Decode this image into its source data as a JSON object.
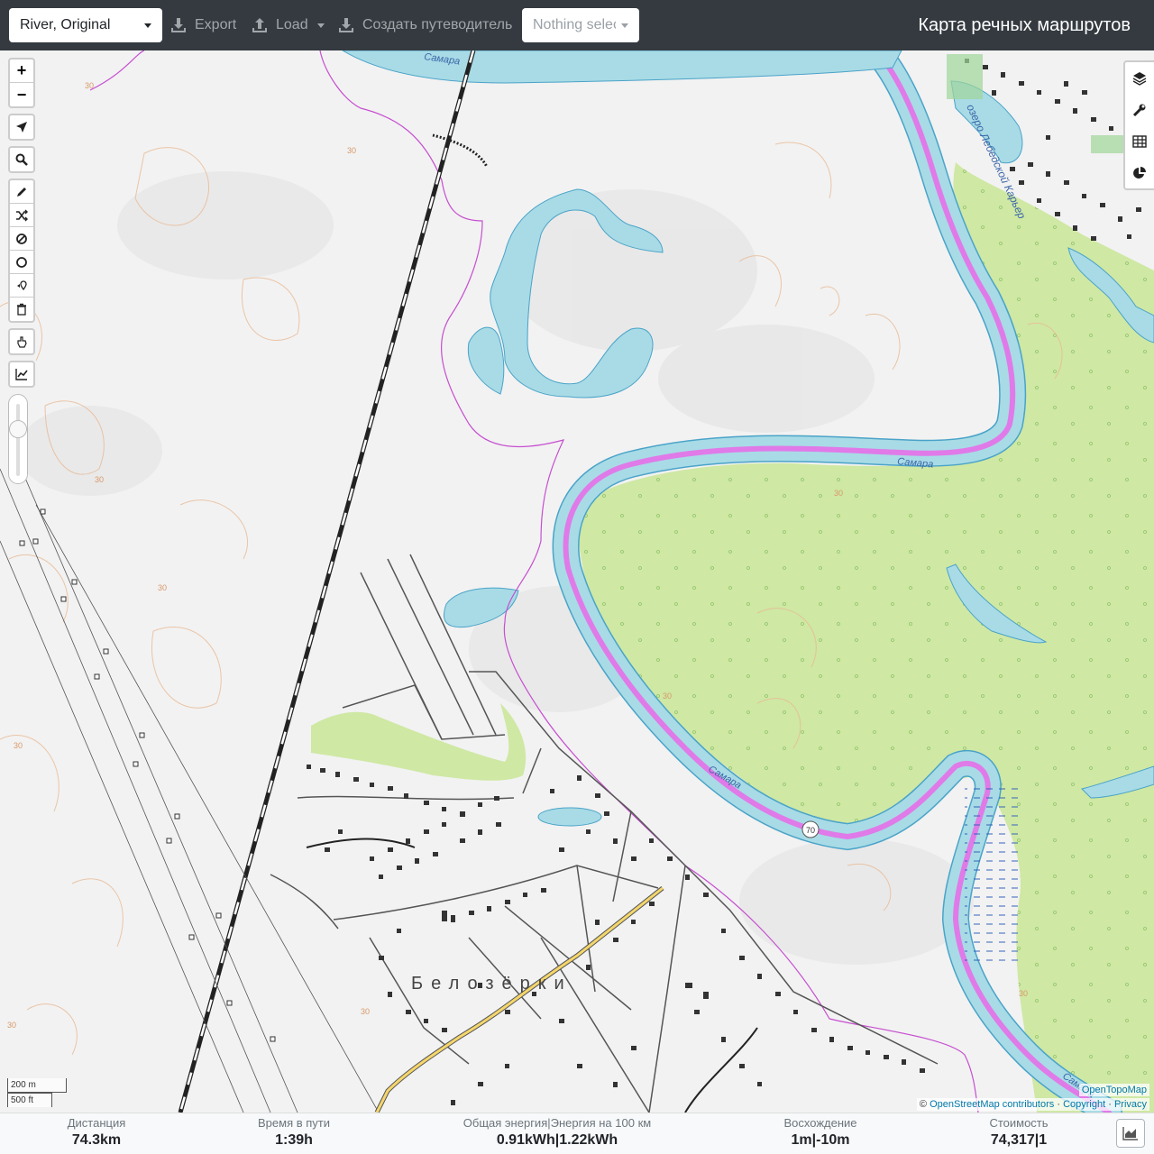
{
  "topbar": {
    "profile": "River, Original",
    "export_label": "Export",
    "load_label": "Load",
    "guide_label": "Создать путеводитель",
    "nothing_selected": "Nothing selected",
    "app_title": "Карта речных маршрутов"
  },
  "map": {
    "labels": {
      "samara_top": "Самара",
      "samara_mid": "Самара",
      "samara_low": "Самара",
      "samara_br": "Самара",
      "lake": "озеро Лебедской Карьер",
      "village": "Белозёрки",
      "road_shield": "70"
    },
    "contour": [
      "30",
      "30",
      "30",
      "30",
      "30",
      "30",
      "30",
      "30",
      "30",
      "30"
    ],
    "scale_m": "200 m",
    "scale_ft": "500 ft",
    "attribution_top": "OpenTopoMap",
    "attribution_copy": "©",
    "attribution_osm": "OpenStreetMap contributors",
    "attribution_sep1": "·",
    "attribution_copyright": "Copyright",
    "attribution_sep2": "·",
    "attribution_privacy": "Privacy"
  },
  "left_controls": {
    "zoom_in": "+",
    "zoom_out": "−"
  },
  "stats": {
    "distance_label": "Дистанция",
    "distance_value": "74.3",
    "distance_unit": "km",
    "time_label": "Время в пути",
    "time_value": "1:39",
    "time_unit": "h",
    "energy_label": "Общая энергия|Энергия на 100 км",
    "energy_value1": "0.91",
    "energy_unit1": "kWh",
    "energy_sep": "|",
    "energy_value2": "1.22",
    "energy_unit2": "kWh",
    "ascent_label": "Восхождение",
    "ascent_value1": "1",
    "ascent_unit1": "m",
    "ascent_sep": "|",
    "ascent_value2": "-10",
    "ascent_unit2": "m",
    "cost_label": "Стоимость",
    "cost_value": "74,317",
    "cost_sep": "|",
    "cost_value2": "1"
  },
  "colors": {
    "toolbar": "#343a40",
    "water": "#a8dbe6",
    "river_stroke": "#4aa3c8",
    "route": "#e07ae8",
    "forest": "#cde9a0",
    "boundary": "#c64fd0"
  }
}
